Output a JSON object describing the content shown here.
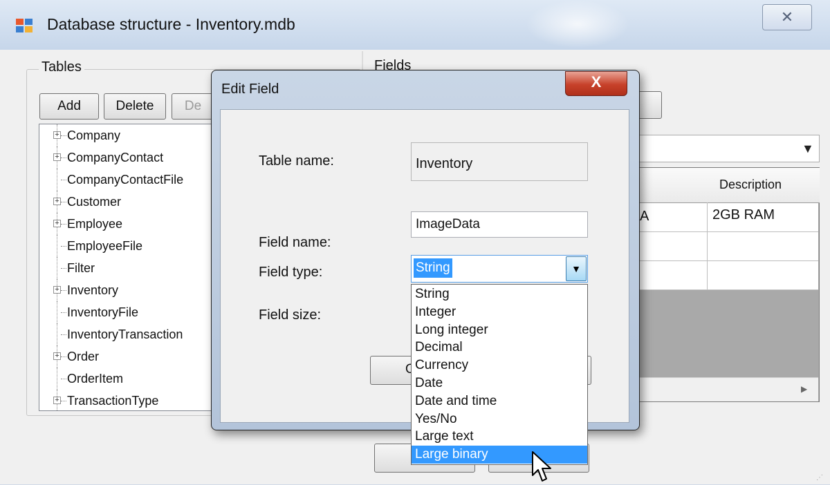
{
  "main_window": {
    "title": "Database structure - Inventory.mdb",
    "close_glyph": "✕",
    "app_icon": "table-grid-icon"
  },
  "tables_panel": {
    "label": "Tables",
    "buttons": {
      "add": "Add",
      "delete": "Delete",
      "design": "De"
    },
    "tree_items": [
      {
        "label": "Company",
        "expandable": true
      },
      {
        "label": "CompanyContact",
        "expandable": true
      },
      {
        "label": "CompanyContactFile",
        "expandable": false
      },
      {
        "label": "Customer",
        "expandable": true
      },
      {
        "label": "Employee",
        "expandable": true
      },
      {
        "label": "EmployeeFile",
        "expandable": false
      },
      {
        "label": "Filter",
        "expandable": false
      },
      {
        "label": "Inventory",
        "expandable": true
      },
      {
        "label": "InventoryFile",
        "expandable": false
      },
      {
        "label": "InventoryTransaction",
        "expandable": false
      },
      {
        "label": "Order",
        "expandable": true
      },
      {
        "label": "OrderItem",
        "expandable": false
      },
      {
        "label": "TransactionType",
        "expandable": true
      }
    ]
  },
  "fields_panel": {
    "label": "Fields",
    "grid": {
      "header_description": "Description",
      "row1_prev_cell": "A",
      "row1_description": "2GB RAM"
    }
  },
  "dialog": {
    "title": "Edit Field",
    "close_glyph": "X",
    "table_name_label": "Table name:",
    "table_name_value": "Inventory",
    "field_name_label": "Field name:",
    "field_name_value": "ImageData",
    "field_type_label": "Field type:",
    "field_type_selected": "String",
    "field_size_label": "Field size:",
    "ok_button_partial": "O"
  },
  "field_type_options": [
    "String",
    "Integer",
    "Long integer",
    "Decimal",
    "Currency",
    "Date",
    "Date and time",
    "Yes/No",
    "Large text",
    "Large binary"
  ],
  "highlighted_option": "Large binary",
  "colors": {
    "selection": "#3399ff",
    "dialog_close": "#c7412a",
    "window_face": "#f0f0f0"
  }
}
